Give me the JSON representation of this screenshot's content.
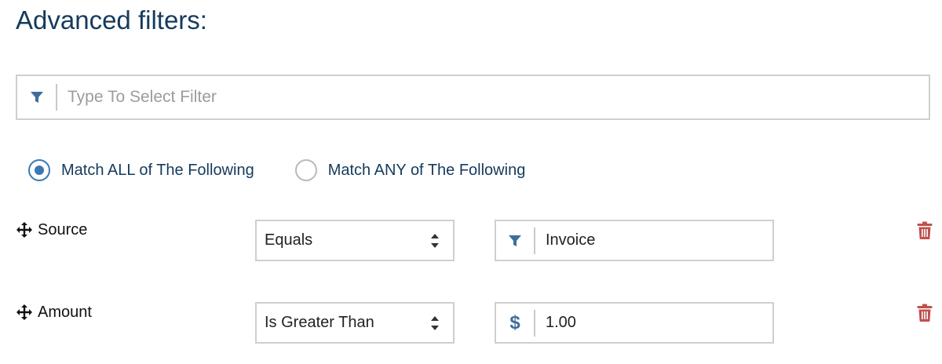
{
  "title": "Advanced filters:",
  "filter_search": {
    "icon": "filter-icon",
    "placeholder": "Type To Select Filter",
    "value": ""
  },
  "match_mode": {
    "options": [
      {
        "label": "Match ALL of The Following",
        "checked": true
      },
      {
        "label": "Match ANY of The Following",
        "checked": false
      }
    ]
  },
  "rules": [
    {
      "field": "Source",
      "operator": "Equals",
      "value_icon": "filter-icon",
      "value": "Invoice",
      "delete_icon": "trash-icon"
    },
    {
      "field": "Amount",
      "operator": "Is Greater Than",
      "value_icon": "dollar-icon",
      "value_symbol": "$",
      "value": "1.00",
      "delete_icon": "trash-icon"
    }
  ],
  "colors": {
    "title": "#153a5c",
    "accent": "#3a78b5",
    "icon": "#3d6e9a",
    "delete": "#c0504d",
    "border": "#cfcfcf"
  }
}
